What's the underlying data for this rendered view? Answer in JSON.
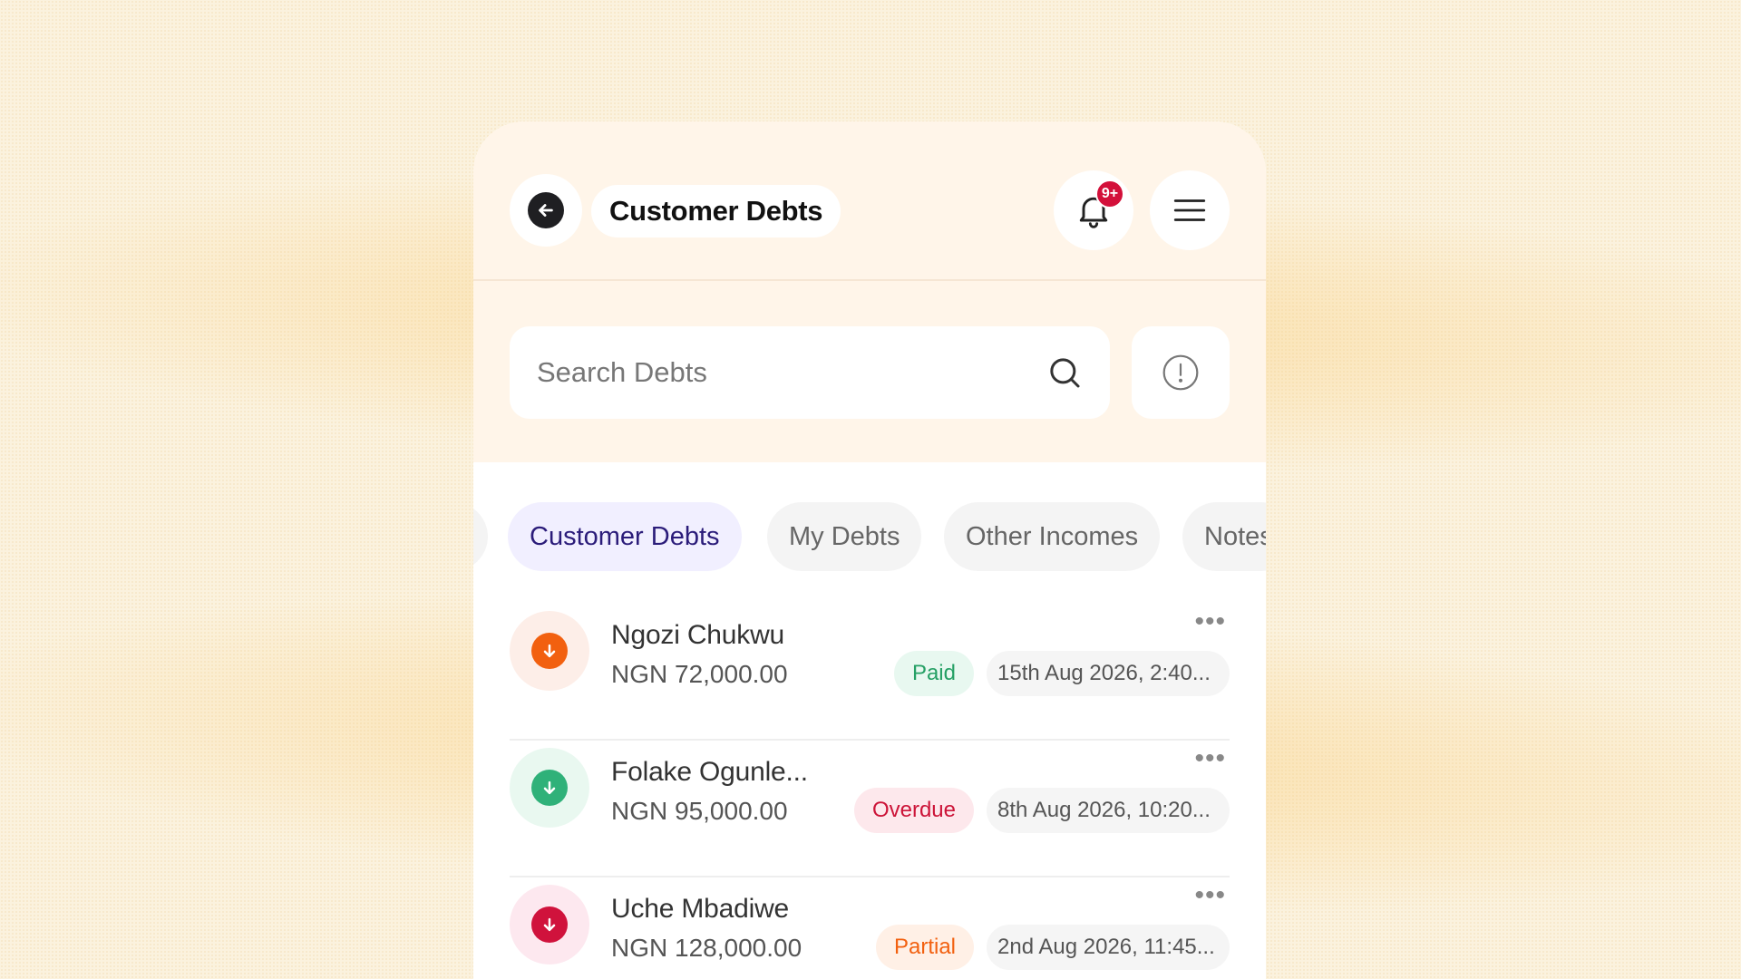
{
  "header": {
    "title": "Customer Debts",
    "notification_badge": "9+"
  },
  "search": {
    "placeholder": "Search Debts"
  },
  "tabs": [
    {
      "label": "Customer Debts",
      "active": true
    },
    {
      "label": "My Debts",
      "active": false
    },
    {
      "label": "Other Incomes",
      "active": false
    },
    {
      "label": "Notes",
      "active": false
    }
  ],
  "debts": [
    {
      "name": "Ngozi Chukwu",
      "amount": "NGN 72,000.00",
      "status": "Paid",
      "date": "15th Aug 2026, 2:40...",
      "icon": "arrow-down-icon",
      "icon_color": "#f2600f",
      "icon_bg": "#fdeee8",
      "status_color": "#25a065",
      "status_bg": "#e8f8f0"
    },
    {
      "name": "Folake Ogunle...",
      "amount": "NGN 95,000.00",
      "status": "Overdue",
      "date": "8th Aug 2026, 10:20...",
      "icon": "arrow-down-icon",
      "icon_color": "#2fb179",
      "icon_bg": "#e9f8f0",
      "status_color": "#cc1438",
      "status_bg": "#fde8ec"
    },
    {
      "name": "Uche Mbadiwe",
      "amount": "NGN 128,000.00",
      "status": "Partial",
      "date": "2nd Aug 2026, 11:45...",
      "icon": "arrow-down-icon",
      "icon_color": "#d0123c",
      "icon_bg": "#fde8ef",
      "status_color": "#f2600f",
      "status_bg": "#fff0e6"
    }
  ]
}
